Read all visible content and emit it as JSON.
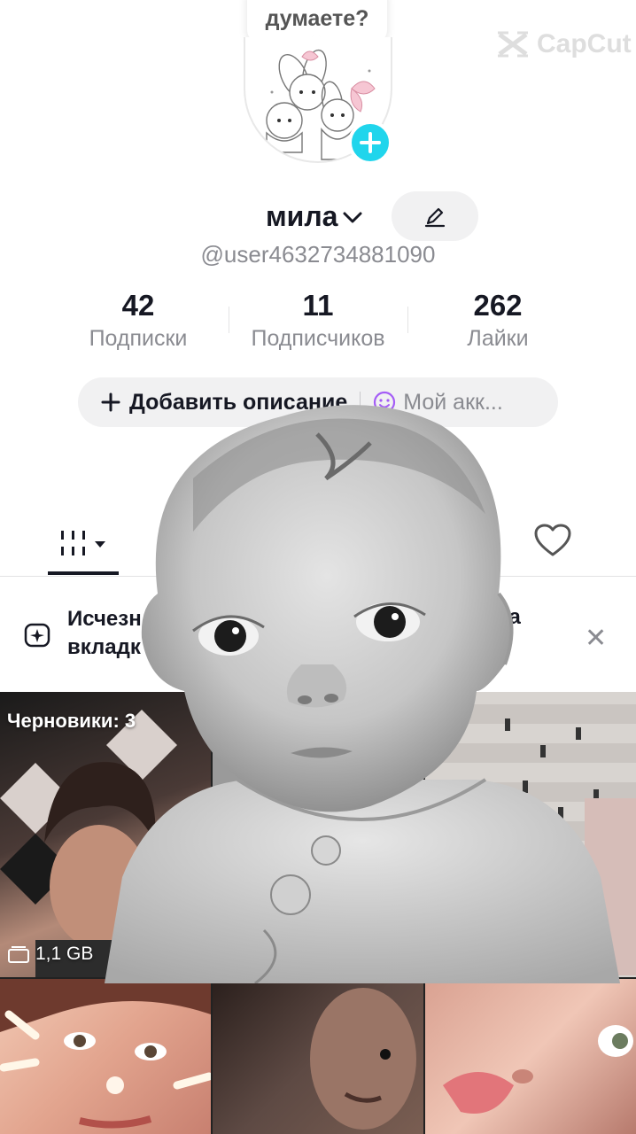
{
  "bubble": {
    "text": "думаете?"
  },
  "watermark": {
    "text": "CapCut"
  },
  "profile": {
    "display_name": "мила",
    "username": "@user4632734881090"
  },
  "stats": [
    {
      "value": "42",
      "label": "Подписки"
    },
    {
      "value": "11",
      "label": "Подписчиков"
    },
    {
      "value": "262",
      "label": "Лайки"
    }
  ],
  "pills": {
    "add_bio": "Добавить описание",
    "account": "Мой акк..."
  },
  "banner": {
    "line1": "Исчезн",
    "line2": "вкладк",
    "line1_tail": "на"
  },
  "grid": {
    "drafts_label": "Черновики: 3",
    "size_label": "1,1 GB"
  },
  "colors": {
    "accent": "#20d5ec",
    "text_primary": "#161823",
    "text_secondary": "#8a8b91",
    "pill_bg": "#f1f1f2"
  }
}
